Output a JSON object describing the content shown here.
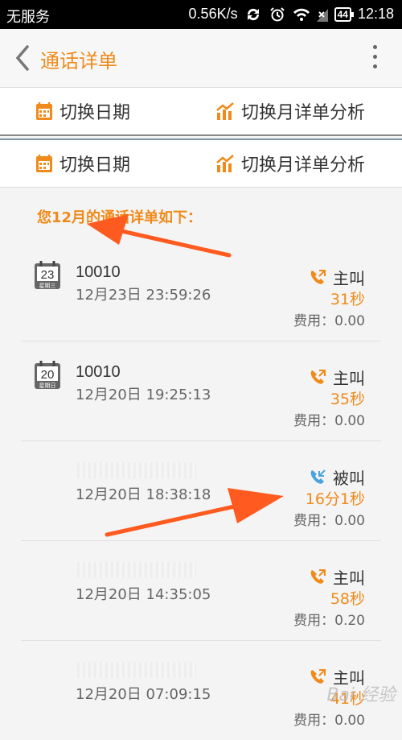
{
  "status_bar": {
    "carrier": "无服务",
    "speed": "0.56K/s",
    "battery": "44",
    "time": "12:18"
  },
  "app_bar": {
    "title": "通话详单"
  },
  "actions": [
    {
      "switch_date": "切换日期",
      "monthly_analysis": "切换月详单分析"
    },
    {
      "switch_date": "切换日期",
      "monthly_analysis": "切换月详单分析"
    }
  ],
  "summary": "您12月的通话详单如下：",
  "records": [
    {
      "cal_day": "23",
      "cal_week": "星期三",
      "number": "10010",
      "time": "12月23日  23:59:26",
      "type": "主叫",
      "direction": "outgoing",
      "duration": "31秒",
      "fee": "费用：0.00"
    },
    {
      "cal_day": "20",
      "cal_week": "星期日",
      "number": "10010",
      "time": "12月20日  19:25:13",
      "type": "主叫",
      "direction": "outgoing",
      "duration": "35秒",
      "fee": "费用：0.00"
    },
    {
      "cal_day": "",
      "cal_week": "",
      "number": "",
      "time": "12月20日  18:38:18",
      "type": "被叫",
      "direction": "incoming",
      "duration": "16分1秒",
      "fee": "费用：0.00"
    },
    {
      "cal_day": "",
      "cal_week": "",
      "number": "",
      "time": "12月20日  14:35:05",
      "type": "主叫",
      "direction": "outgoing",
      "duration": "58秒",
      "fee": "费用：0.20"
    },
    {
      "cal_day": "",
      "cal_week": "",
      "number": "",
      "time": "12月20日  07:09:15",
      "type": "主叫",
      "direction": "outgoing",
      "duration": "41秒",
      "fee": "费用：0.00"
    }
  ],
  "colors": {
    "accent": "#f08a1a",
    "outgoing": "#f08a1a",
    "incoming": "#4aa3df",
    "arrow": "#ff5a1f"
  },
  "icons": {
    "back": "chevron-left-icon",
    "menu": "more-vert-icon",
    "calendar": "calendar-icon",
    "chart": "chart-icon",
    "call_out": "outgoing-call-icon",
    "call_in": "incoming-call-icon"
  },
  "watermark": "Bai 经验"
}
